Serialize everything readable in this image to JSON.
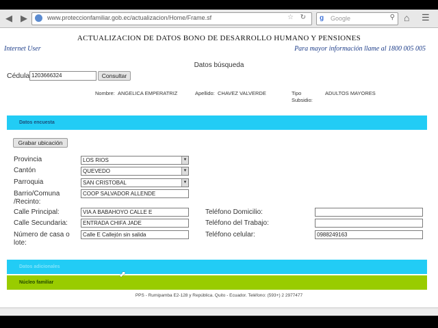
{
  "browser": {
    "url": "www.proteccionfamiliar.gob.ec/actualizacion/Home/Frame.sf",
    "search_placeholder": "Google"
  },
  "header": {
    "title": "ACTUALIZACION DE DATOS BONO DE DESARROLLO HUMANO Y PENSIONES",
    "user": "Internet User",
    "info": "Para mayor información llame al 1800 005 005"
  },
  "search": {
    "title": "Datos búsqueda",
    "cedula_label": "Cédula",
    "cedula_value": "1203666324",
    "consult_label": "Consultar"
  },
  "person": {
    "nombre_label": "Nombre:",
    "nombre_value": "ANGELICA EMPERATRIZ",
    "apellido_label": "Apellido:",
    "apellido_value": "CHAVEZ VALVERDE",
    "tipo_label_1": "Tipo",
    "tipo_label_2": "Subsidio:",
    "tipo_value": "ADULTOS MAYORES"
  },
  "sections": {
    "encuesta": "Datos encuesta",
    "adicionales": "Datos adicionales",
    "nucleo": "Núcleo familiar"
  },
  "form": {
    "save_location_label": "Grabar ubicación",
    "provincia_label": "Provincia",
    "provincia_value": "LOS RIOS",
    "canton_label": "Cantón",
    "canton_value": "QUEVEDO",
    "parroquia_label": "Parroquia",
    "parroquia_value": "SAN CRISTOBAL",
    "barrio_label_1": "Barrio/Comuna",
    "barrio_label_2": "/Recinto:",
    "barrio_value": "COOP SALVADOR ALLENDE",
    "calle_principal_label": "Calle Principal:",
    "calle_principal_value": "VIA A BABAHOYO CALLE E",
    "calle_secundaria_label": "Calle Secundaria:",
    "calle_secundaria_value": "ENTRADA CHIFA JADE",
    "numero_label_1": "Número de casa o",
    "numero_label_2": "lote:",
    "numero_value": "Calle E Callejón sin salida",
    "tel_domicilio_label": "Teléfono Domicilio:",
    "tel_domicilio_value": "",
    "tel_trabajo_label": "Teléfono del Trabajo:",
    "tel_trabajo_value": "",
    "tel_celular_label": "Teléfono celular:",
    "tel_celular_value": "0988249163"
  },
  "footer": {
    "text": "PPS - Rumipamba E2-128 y República. Quito - Ecuador. Teléfono: (593+) 2 2977477"
  },
  "colors": {
    "band_blue": "#22ccf5",
    "band_green": "#99cc00",
    "header_italic": "#1e3e8a"
  }
}
